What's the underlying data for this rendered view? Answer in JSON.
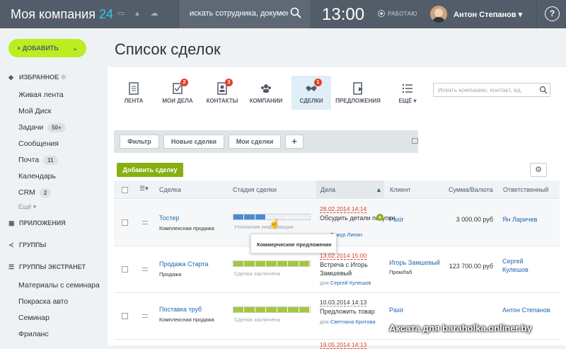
{
  "header": {
    "logo_text": "Моя компания",
    "logo_num": "24",
    "search_placeholder": "искать сотрудника, документ, пр",
    "time": "13:00",
    "status": "РАБОТАЮ",
    "user_name": "Антон Степанов",
    "help": "?"
  },
  "sidebar": {
    "add_label": "ДОБАВИТЬ",
    "favorites": "ИЗБРАННОЕ",
    "items": [
      {
        "label": "Живая лента"
      },
      {
        "label": "Мой Диск"
      },
      {
        "label": "Задачи",
        "count": "50+"
      },
      {
        "label": "Сообщения"
      },
      {
        "label": "Почта",
        "count": "11"
      },
      {
        "label": "Календарь"
      },
      {
        "label": "CRM",
        "count": "2"
      }
    ],
    "more": "Ещё ▾",
    "apps": "ПРИЛОЖЕНИЯ",
    "groups": "ГРУППЫ",
    "extranet": "ГРУППЫ ЭКСТРАНЕТ",
    "extranet_items": [
      "Материалы с семинара",
      "Покраска авто",
      "Семинар",
      "Фриланс"
    ]
  },
  "page": {
    "title": "Список сделок"
  },
  "tabs": [
    {
      "label": "ЛЕНТА",
      "icon": "document-icon"
    },
    {
      "label": "МОИ ДЕЛА",
      "icon": "checklist-icon",
      "badge": "2"
    },
    {
      "label": "КОНТАКТЫ",
      "icon": "contact-card-icon",
      "badge": "3"
    },
    {
      "label": "КОМПАНИИ",
      "icon": "people-icon"
    },
    {
      "label": "СДЕЛКИ",
      "icon": "handshake-icon",
      "badge": "1"
    },
    {
      "label": "ПРЕДЛОЖЕНИЯ",
      "icon": "proposal-icon"
    },
    {
      "label": "ЕЩЁ ▾",
      "icon": "list-icon"
    }
  ],
  "crm_search": "Искать компанию, контакт, ид.",
  "filters": {
    "filter": "Фильтр",
    "new_deals": "Новые сделки",
    "my_deals": "Мои сделки",
    "add": "+"
  },
  "add_deal": "Добавить сделку",
  "table": {
    "headers": {
      "deal": "Сделка",
      "stage": "Стадия сделки",
      "task": "Дела",
      "client": "Клиент",
      "sum": "Сумма/Валюта",
      "resp": "Ответственный"
    },
    "rows": [
      {
        "name": "Тостер",
        "type": "Комплексная продажа",
        "stage_label": "Уточнение информации",
        "stage_fill": 0.4,
        "stage_color": "#4a8bd6",
        "date": "28.02.2014 14:14",
        "task": "Обсудить детали покупки",
        "task2": "",
        "for": "для",
        "for_name": "Тимур Липин",
        "client": "Paxir",
        "client_sub": "",
        "sum": "3 000.00 руб",
        "resp": "Ян Ларичев",
        "resp2": ""
      },
      {
        "name": "Продажа Старта",
        "type": "Продажа",
        "stage_label": "Сделка заключена",
        "stage_fill": 1,
        "stage_color": "#a5c83a",
        "date": "13.02.2014 15:00",
        "task": "Встреча с Игорь",
        "task2": "Замшевый",
        "for": "для",
        "for_name": "Сергей Кулешов",
        "client": "Игорь Замшевый",
        "client_sub": "ПромЛаб",
        "sum": "123 700.00 руб",
        "resp": "Сергей",
        "resp2": "Кулешов"
      },
      {
        "name": "Поставка труб",
        "type": "Комплексная продажа",
        "stage_label": "Сделка заключена",
        "stage_fill": 1,
        "stage_color": "#a5c83a",
        "date": "10.03.2014 14:13",
        "task": "Предложить товар",
        "task2": "",
        "for": "для",
        "for_name": "Светлана Кротова",
        "client": "Paxir",
        "client_sub": "",
        "sum": "",
        "resp": "Антон Степанов",
        "resp2": ""
      }
    ],
    "next_date": "19.05.2014 14:13"
  },
  "tooltip": "Коммерческое предложение",
  "watermark": "Аксата для baraholka.onliner.by"
}
